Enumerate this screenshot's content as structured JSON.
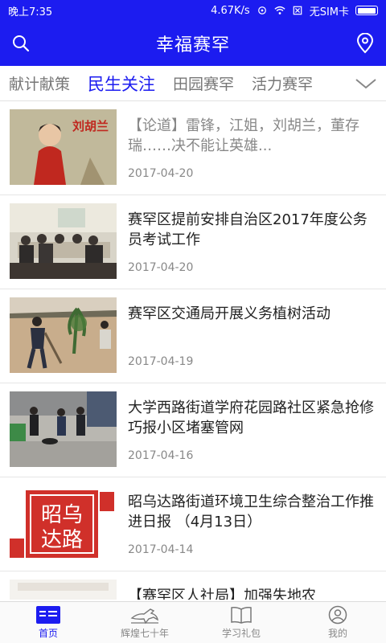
{
  "status_bar": {
    "time": "晚上7:35",
    "speed": "4.67K/s",
    "sim": "无SIM卡"
  },
  "header": {
    "title": "幸福赛罕"
  },
  "tabs": [
    {
      "label": "献计献策",
      "active": false
    },
    {
      "label": "民生关注",
      "active": true
    },
    {
      "label": "田园赛罕",
      "active": false
    },
    {
      "label": "活力赛罕",
      "active": false
    }
  ],
  "news": [
    {
      "title": "【论道】雷锋，江姐，刘胡兰，董存瑞……决不能让英雄...",
      "date": "2017-04-20",
      "read": true,
      "image": "poster"
    },
    {
      "title": "赛罕区提前安排自治区2017年度公务员考试工作",
      "date": "2017-04-20",
      "read": false,
      "image": "meeting"
    },
    {
      "title": "赛罕区交通局开展义务植树活动",
      "date": "2017-04-19",
      "read": false,
      "image": "planting"
    },
    {
      "title": "大学西路街道学府花园路社区紧急抢修巧报小区堵塞管网",
      "date": "2017-04-16",
      "read": false,
      "image": "repair"
    },
    {
      "title": "昭乌达路街道环境卫生综合整治工作推进日报 （4月13日）",
      "date": "2017-04-14",
      "read": false,
      "image": "seal"
    },
    {
      "title": "【赛罕区人社局】加强失地农",
      "date": "",
      "read": false,
      "image": "blank"
    }
  ],
  "seal_text": "昭乌达路",
  "bottom_nav": [
    {
      "label": "首页",
      "icon": "home-icon",
      "active": true
    },
    {
      "label": "辉煌七十年",
      "icon": "horse-icon",
      "active": false
    },
    {
      "label": "学习礼包",
      "icon": "book-icon",
      "active": false
    },
    {
      "label": "我的",
      "icon": "profile-icon",
      "active": false
    }
  ],
  "colors": {
    "brand": "#1c1cf0",
    "text": "#222222",
    "muted": "#888888"
  }
}
